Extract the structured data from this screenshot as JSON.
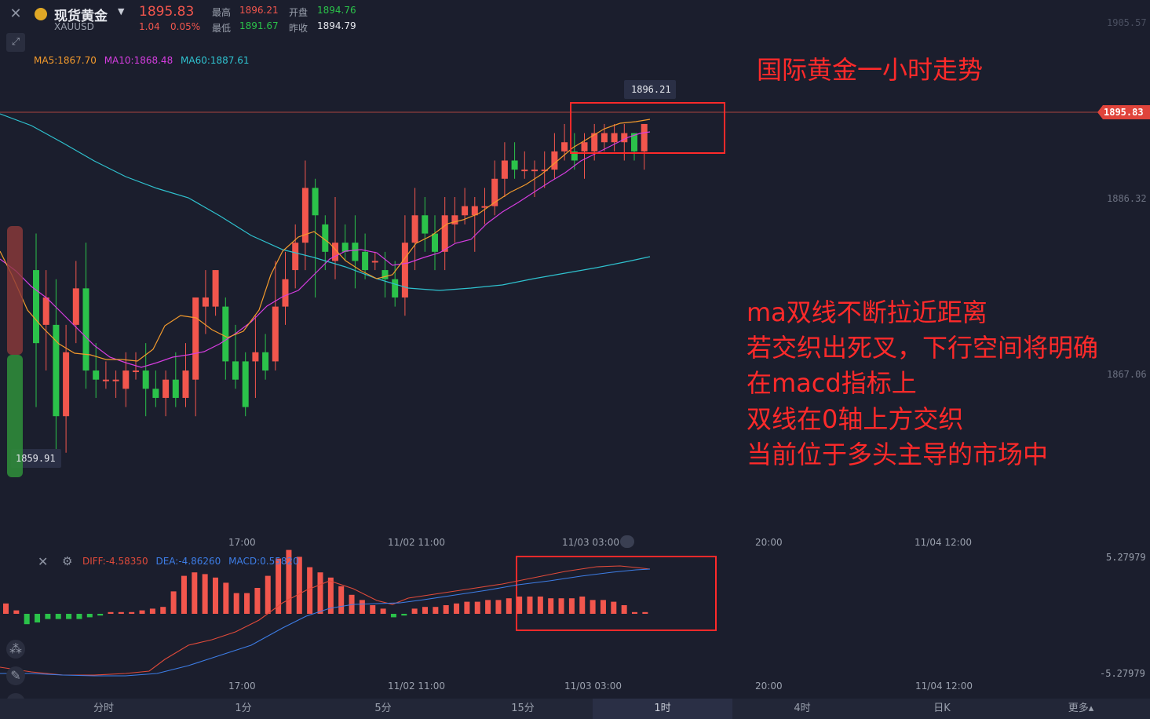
{
  "header": {
    "instrument_name": "现货黄金",
    "symbol": "XAUUSD",
    "price": "1895.83",
    "change": "1.04",
    "change_pct": "0.05%",
    "high_label": "最高",
    "high_value": "1896.21",
    "open_label": "开盘",
    "open_value": "1894.76",
    "low_label": "最低",
    "low_value": "1891.67",
    "prev_close_label": "昨收",
    "prev_close_value": "1894.79"
  },
  "ma_legend": {
    "ma5": "MA5:1867.70",
    "ma10": "MA10:1868.48",
    "ma60": "MA60:1887.61"
  },
  "macd_legend": {
    "diff": "DIFF:-4.58350",
    "dea": "DEA:-4.86260",
    "macd": "MACD:0.55820"
  },
  "price_axis": {
    "p1": "1905.57",
    "p2": "1886.32",
    "p3": "1867.06",
    "current": "1895.83"
  },
  "macd_axis": {
    "top": "5.27979",
    "bottom": "-5.27979"
  },
  "time_axis": [
    "17:00",
    "11/02 11:00",
    "11/03 03:00",
    "20:00",
    "11/04 12:00"
  ],
  "markers": {
    "high": "1896.21",
    "low": "1859.91"
  },
  "annotations": {
    "title": "国际黄金一小时走势",
    "line1": "ma双线不断拉近距离",
    "line2": "若交织出死叉，下行空间将明确",
    "line3": "在macd指标上",
    "line4": "双线在0轴上方交织",
    "line5": "当前位于多头主导的市场中"
  },
  "timeframes": [
    "分时",
    "1分",
    "5分",
    "15分",
    "1时",
    "4时",
    "日K",
    "更多▴"
  ],
  "colors": {
    "up": "#f2564d",
    "down": "#2bc24a",
    "ma5": "#f39a2c",
    "ma10": "#d63de0",
    "ma60": "#2fc2cf",
    "annotation": "#ff2a2a",
    "dea": "#3d7de6"
  },
  "chart_data": {
    "type": "candlestick",
    "title": "",
    "xlabel": "",
    "ylabel": "",
    "ylim": [
      1858,
      1907
    ],
    "candles": [
      [
        1880,
        1872,
        1884,
        1865
      ],
      [
        1874,
        1877,
        1880,
        1869
      ],
      [
        1874,
        1864,
        1879,
        1860
      ],
      [
        1864,
        1871,
        1874,
        1860
      ],
      [
        1874,
        1878,
        1881,
        1872
      ],
      [
        1878,
        1869,
        1883,
        1867
      ],
      [
        1869,
        1868,
        1872,
        1866
      ],
      [
        1868,
        1868,
        1870,
        1867
      ],
      [
        1868,
        1868,
        1869,
        1866
      ],
      [
        1867,
        1869,
        1871,
        1865
      ],
      [
        1869,
        1869,
        1871,
        1868
      ],
      [
        1869,
        1867,
        1872,
        1864
      ],
      [
        1867,
        1866,
        1869,
        1865
      ],
      [
        1866,
        1868,
        1869,
        1864
      ],
      [
        1868,
        1866,
        1871,
        1865
      ],
      [
        1866,
        1869,
        1872,
        1865
      ],
      [
        1868,
        1877,
        1877,
        1864
      ],
      [
        1876,
        1877,
        1880,
        1873
      ],
      [
        1876,
        1880,
        1880,
        1875
      ],
      [
        1876,
        1870,
        1877,
        1868
      ],
      [
        1870,
        1868,
        1874,
        1867
      ],
      [
        1870,
        1865,
        1871,
        1864
      ],
      [
        1870,
        1871,
        1875,
        1866
      ],
      [
        1871,
        1869,
        1873,
        1868
      ],
      [
        1870,
        1876,
        1881,
        1869
      ],
      [
        1876,
        1879,
        1882,
        1874
      ],
      [
        1880,
        1883,
        1885,
        1878
      ],
      [
        1883,
        1889,
        1892,
        1880
      ],
      [
        1889,
        1886,
        1890,
        1877
      ],
      [
        1885,
        1882,
        1886,
        1880
      ],
      [
        1881,
        1883,
        1888,
        1879
      ],
      [
        1883,
        1882,
        1885,
        1881
      ],
      [
        1883,
        1881,
        1886,
        1878
      ],
      [
        1882,
        1880,
        1884,
        1879
      ],
      [
        1881,
        1881,
        1882,
        1880
      ],
      [
        1880,
        1879,
        1882,
        1877
      ],
      [
        1879,
        1877,
        1881,
        1876
      ],
      [
        1877,
        1883,
        1886,
        1875
      ],
      [
        1883,
        1886,
        1889,
        1880
      ],
      [
        1886,
        1884,
        1888,
        1882
      ],
      [
        1884,
        1882,
        1886,
        1880
      ],
      [
        1882,
        1886,
        1888,
        1880
      ],
      [
        1885,
        1886,
        1888,
        1883
      ],
      [
        1886,
        1887,
        1889,
        1885
      ],
      [
        1886,
        1887,
        1888,
        1882
      ],
      [
        1887,
        1887,
        1889,
        1885
      ],
      [
        1887,
        1890,
        1892,
        1886
      ],
      [
        1890,
        1892,
        1894,
        1888
      ],
      [
        1892,
        1891,
        1894,
        1890
      ],
      [
        1891,
        1891,
        1893,
        1890
      ],
      [
        1891,
        1891,
        1892,
        1888
      ],
      [
        1891,
        1891,
        1893,
        1889
      ],
      [
        1891,
        1893,
        1895,
        1890
      ],
      [
        1893,
        1894,
        1896,
        1892
      ],
      [
        1893,
        1892,
        1895,
        1891
      ],
      [
        1893,
        1894,
        1895,
        1890
      ],
      [
        1893,
        1895,
        1896,
        1892
      ],
      [
        1894,
        1895,
        1896,
        1893
      ],
      [
        1894,
        1895,
        1896,
        1893
      ],
      [
        1894,
        1895,
        1896,
        1892
      ],
      [
        1895,
        1893,
        1895,
        1892
      ],
      [
        1893,
        1896,
        1896,
        1891
      ]
    ],
    "macd_hist": [
      0.6,
      0.2,
      -0.6,
      -0.5,
      -0.3,
      -0.3,
      -0.3,
      -0.3,
      -0.2,
      -0.1,
      0.1,
      0.1,
      0.1,
      0.2,
      0.3,
      0.4,
      1.3,
      2.2,
      2.4,
      2.3,
      2.1,
      1.8,
      1.2,
      1.2,
      1.5,
      2.2,
      3.2,
      3.7,
      3.3,
      2.7,
      2.4,
      2.1,
      1.6,
      1.1,
      0.8,
      0.5,
      0.3,
      -0.2,
      -0.1,
      0.3,
      0.4,
      0.4,
      0.5,
      0.6,
      0.7,
      0.7,
      0.8,
      0.8,
      0.9,
      1.0,
      1.0,
      1.0,
      0.9,
      0.9,
      0.9,
      1.0,
      0.8,
      0.8,
      0.7,
      0.5,
      0.1,
      0.1
    ]
  }
}
